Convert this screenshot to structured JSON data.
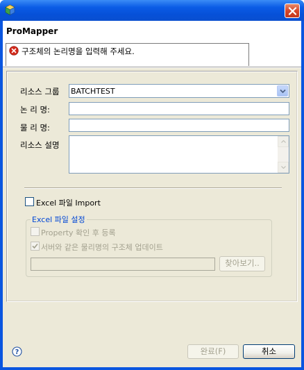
{
  "window": {
    "title": ""
  },
  "header": {
    "title": "ProMapper",
    "error_message": "구조체의 논리명을 입력해 주세요."
  },
  "form": {
    "resource_group_label": "리소스 그룹",
    "resource_group_value": "BATCHTEST",
    "logical_name_label": "논 리 명:",
    "logical_name_value": "",
    "physical_name_label": "물 리 명:",
    "physical_name_value": "",
    "resource_desc_label": "리소스 설명",
    "resource_desc_value": ""
  },
  "excel": {
    "import_label": "Excel 파일 Import",
    "import_checked": false,
    "settings_legend": "Excel 파일 설정",
    "property_label": "Property 확인 후 등록",
    "property_checked": false,
    "update_label": "서버와 같은 물리명의 구조체 업데이트",
    "update_checked": true,
    "file_path_value": "",
    "browse_label": "찾아보기.."
  },
  "footer": {
    "finish_label": "완료(F)",
    "cancel_label": "취소"
  },
  "icons": {
    "app": "app-cube-icon",
    "close": "close-icon",
    "error": "error-icon",
    "dropdown": "chevron-down-icon",
    "help": "help-icon"
  },
  "colors": {
    "titlebar": "#0a56e0",
    "client": "#ece9d8",
    "error_red": "#d42a1c",
    "legend_blue": "#0046d5"
  }
}
